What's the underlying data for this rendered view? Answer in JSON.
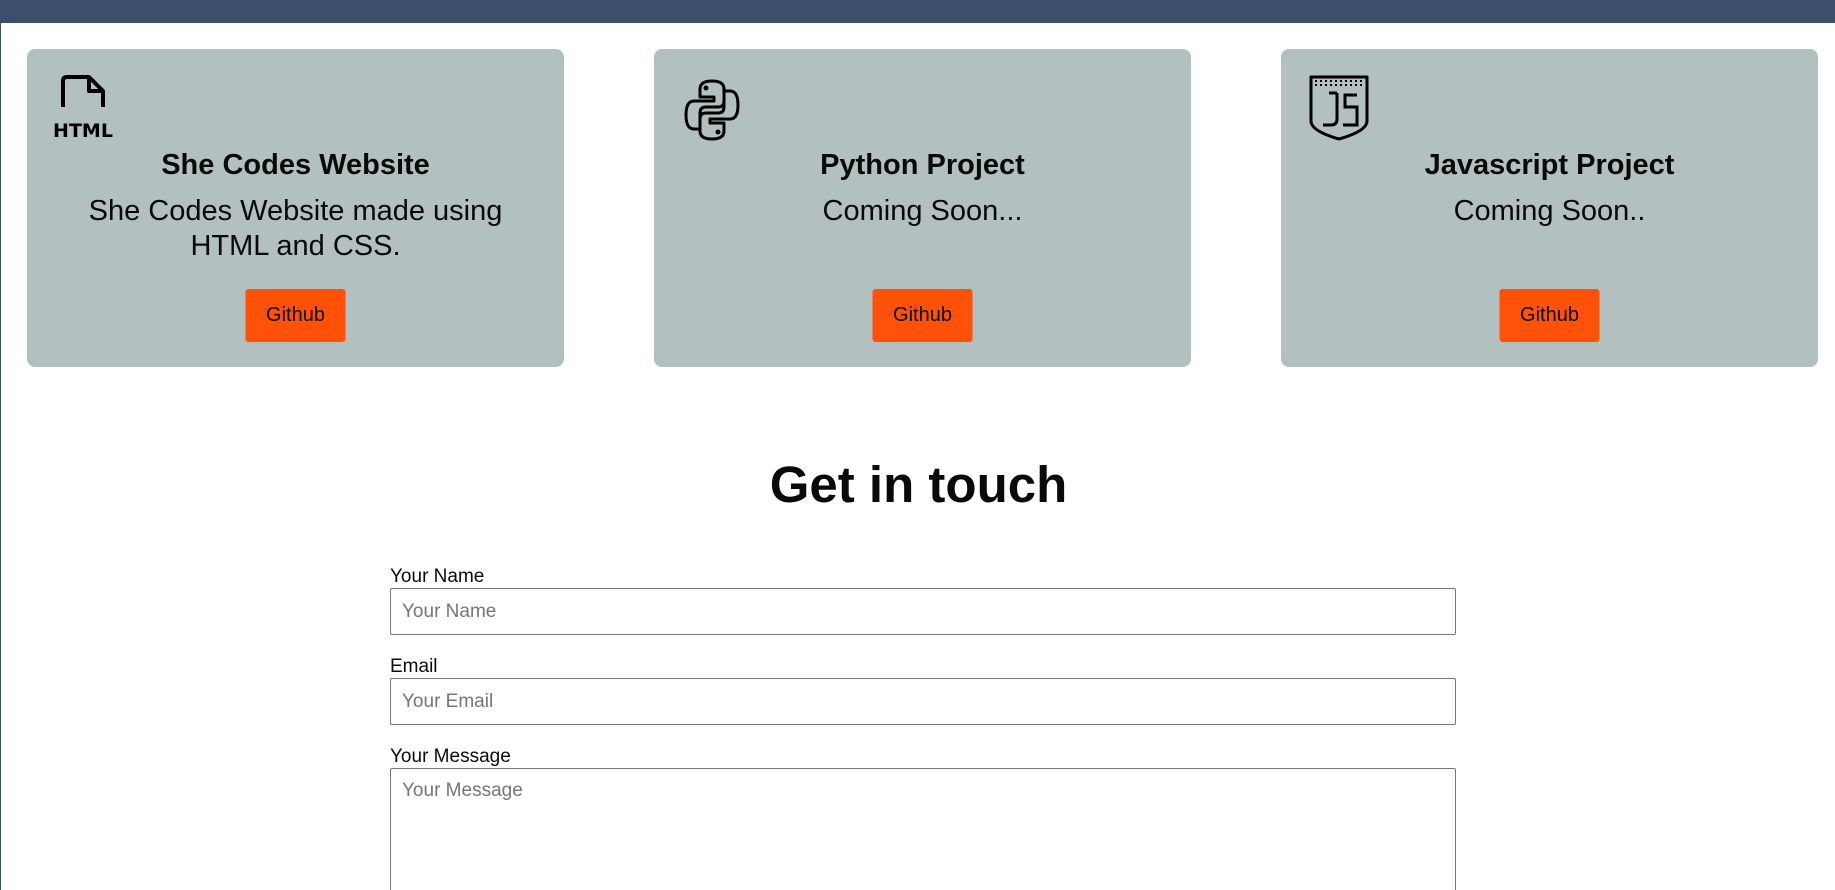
{
  "colors": {
    "topbar": "#3b4f6b",
    "card_background": "#b2c0c0",
    "button_background": "#ff5208"
  },
  "projects": [
    {
      "icon": "html-file-icon",
      "title": "She Codes Website",
      "description": "She Codes Website made using HTML and CSS.",
      "button_label": "Github"
    },
    {
      "icon": "python-icon",
      "title": "Python Project",
      "description": "Coming Soon...",
      "button_label": "Github"
    },
    {
      "icon": "javascript-icon",
      "title": "Javascript Project",
      "description": "Coming Soon..",
      "button_label": "Github"
    }
  ],
  "contact": {
    "title": "Get in touch",
    "name_label": "Your Name",
    "name_placeholder": "Your Name",
    "name_value": "",
    "email_label": "Email",
    "email_placeholder": "Your Email",
    "email_value": "",
    "message_label": "Your Message",
    "message_placeholder": "Your Message",
    "message_value": ""
  }
}
